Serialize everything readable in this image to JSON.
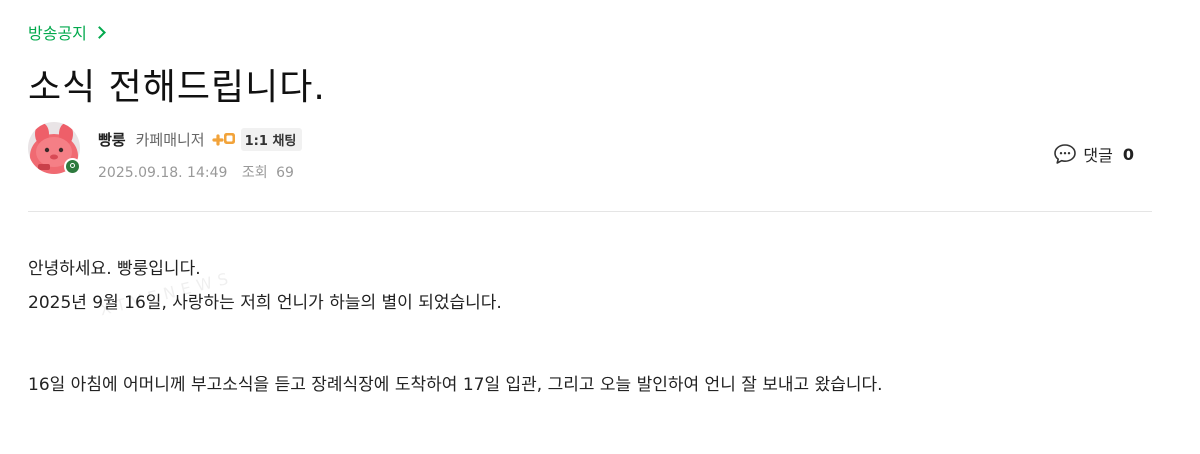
{
  "board": {
    "name": "방송공지"
  },
  "post": {
    "title": "소식 전해드립니다."
  },
  "author": {
    "nickname": "빵룽",
    "role": "카페매니저",
    "chat_label": "1:1 채팅",
    "date": "2025.09.18. 14:49",
    "views_label": "조회",
    "views_count": "69"
  },
  "comments": {
    "label": "댓글",
    "count": "0"
  },
  "content": {
    "lines": [
      "안녕하세요. 빵룽입니다.",
      "2025년 9월 16일, 사랑하는 저희 언니가 하늘의 별이 되었습니다.",
      "16일 아침에 어머니께 부고소식을 듣고 장례식장에 도착하여 17일 입관, 그리고 오늘 발인하여 언니 잘 보내고 왔습니다."
    ]
  },
  "watermark": {
    "text": "XTVENEWS"
  },
  "icons": {
    "chevron": "chevron-right-icon",
    "grade": "cafe-grade-icon",
    "chat": "chat-icon",
    "comment": "comment-bubble-icon",
    "avatar_badge": "manager-badge-icon"
  },
  "colors": {
    "accent": "#03a94d",
    "text": "#222222",
    "muted": "#999999",
    "divider": "#e5e5e5"
  }
}
